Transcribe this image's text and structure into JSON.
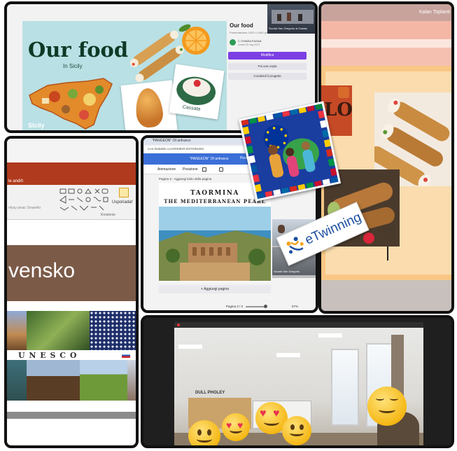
{
  "panel1": {
    "title_main": "Our food",
    "title_sub": "In Sicily",
    "sicily_label": "Sicily",
    "side_title": "Our food",
    "side_meta": "Presentazione 1920 x 1080 px",
    "side_author": "C CHIARA FAGAN",
    "side_date": "creata 28 mag 2023",
    "btn_modify": "Modifica",
    "btn_copy": "Fai una copia",
    "btn_share": "Condividi il progetto",
    "video_label": "Scuola San Gregorio al Cassia",
    "cassata_label": "Cassata"
  },
  "panel2": {
    "corner_name": "Kalan Toplanti",
    "poster_letters": "LO"
  },
  "panel3": {
    "ribbon_text": "le andiň",
    "usporiadat": "Usporiadať",
    "kreslenie": "Kreslenie",
    "font_hint": "nfyay pisac Smarello",
    "big_word": "vensko",
    "unesco": "U N E S C O"
  },
  "panel4": {
    "tab_title": "\"PANGEON\" Of anfrance",
    "url": "icon.thakable.cov/2RE8D9-W4TMNUBS",
    "header_text": "\"PANGEON\" Of anfrance",
    "header_right": "Presen",
    "tool_animation": "Animazione",
    "tool_position": "Posizione",
    "page_label": "Pagina 3 - Aggiungi titolo della pagina",
    "heading1": "TAORMINA",
    "heading2": "THE MEDITERRANEAN PEARL",
    "add_page": "+ Aggiungi pagina",
    "page_counter": "Pagina 3 / 3",
    "zoom": "57%",
    "thumb_caption": "Scuola San Gregorio"
  },
  "panel5": {
    "tag_text": "DULL PHOLEY"
  },
  "twinning": {
    "text": "eTwinning"
  },
  "colors": {
    "border": "#111111",
    "accent_purple": "#7b3fe4",
    "canva_blue": "#3b6fd8",
    "poster_orange": "#f7c680",
    "brown_band": "#7b5a48",
    "dark_red": "#b03a1d"
  }
}
